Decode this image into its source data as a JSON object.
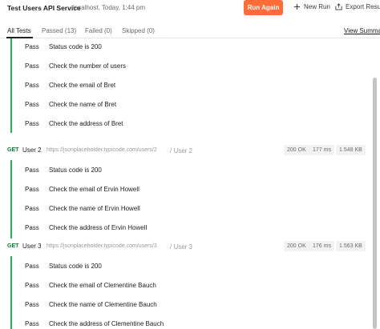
{
  "header": {
    "title": "Test Users API Service",
    "subtitle": "localhost, Today, 1:44 pm",
    "run_again": "Run Again",
    "new_run": "New Run",
    "export": "Export Results"
  },
  "tabs": {
    "all": "All Tests",
    "passed": "Passed (13)",
    "failed": "Failed (0)",
    "skipped": "Skipped (0)",
    "view_summary": "View Summary"
  },
  "group1": {
    "tests": [
      {
        "status": "Pass",
        "name": "Status code is 200"
      },
      {
        "status": "Pass",
        "name": "Check the number of users"
      },
      {
        "status": "Pass",
        "name": "Check the email of Bret"
      },
      {
        "status": "Pass",
        "name": "Check the name of Bret"
      },
      {
        "status": "Pass",
        "name": "Check the address of Bret"
      }
    ]
  },
  "group2": {
    "method": "GET",
    "name": "User 2",
    "url": "https://jsonplaceholder.typicode.com/users/2",
    "path": "/ User 2",
    "status": "200 OK",
    "time": "177 ms",
    "size": "1.548 KB",
    "tests": [
      {
        "status": "Pass",
        "name": "Status code is 200"
      },
      {
        "status": "Pass",
        "name": "Check the email of Ervin Howell"
      },
      {
        "status": "Pass",
        "name": "Check the name of Ervin Howell"
      },
      {
        "status": "Pass",
        "name": "Check the address of Ervin Howell"
      }
    ]
  },
  "group3": {
    "method": "GET",
    "name": "User 3",
    "url": "https://jsonplaceholder.typicode.com/users/3",
    "path": "/ User 3",
    "status": "200 OK",
    "time": "176 ms",
    "size": "1.563 KB",
    "tests": [
      {
        "status": "Pass",
        "name": "Status code is 200"
      },
      {
        "status": "Pass",
        "name": "Check the email of Clementine Bauch"
      },
      {
        "status": "Pass",
        "name": "Check the name of Clementine Bauch"
      },
      {
        "status": "Pass",
        "name": "Check the address of Clementine Bauch"
      }
    ]
  },
  "colors": {
    "accent": "#ff6c37",
    "pass_bar": "#1fb84f",
    "get_method": "#0a7a3b"
  }
}
